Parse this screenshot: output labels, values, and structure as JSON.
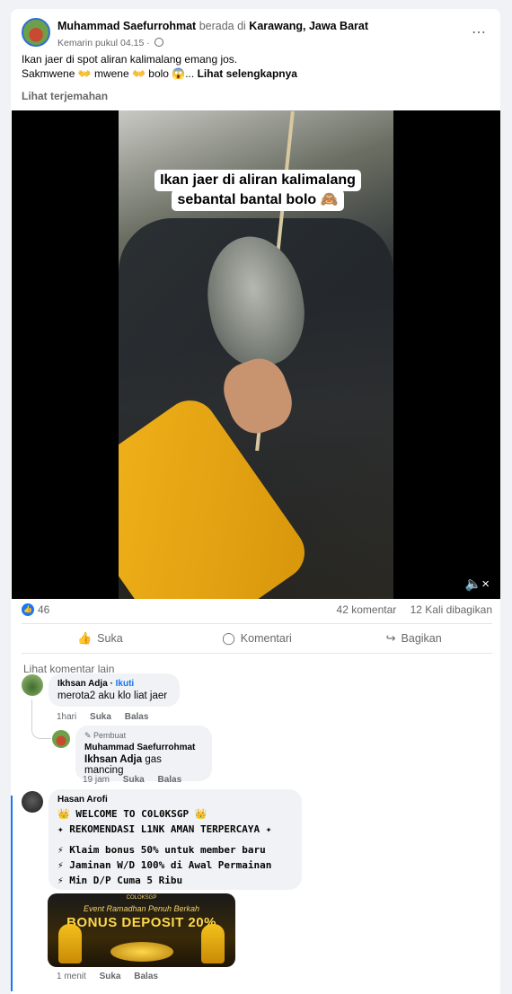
{
  "post": {
    "author": "Muhammad Saefurrohmat",
    "at_text": "berada di",
    "location": "Karawang, Jawa Barat",
    "time": "Kemarin pukul 04.15",
    "text_line1": "Ikan jaer di spot aliran kalimalang emang jos.",
    "text_line2": "Sakmwene 👐 mwene 👐 bolo 😱...",
    "see_more": "Lihat selengkapnya",
    "translate": "Lihat terjemahan",
    "more_icon": "⋯"
  },
  "video": {
    "caption_line1": "Ikan jaer di aliran kalimalang",
    "caption_line2": "sebantal bantal bolo 🙈",
    "mute_icon": "🔈×"
  },
  "stats": {
    "likes": "46",
    "comments": "42 komentar",
    "shares": "12 Kali dibagikan"
  },
  "actions": {
    "like": "Suka",
    "comment": "Komentari",
    "share": "Bagikan"
  },
  "comments_link": "Lihat komentar lain",
  "comments": [
    {
      "name": "Ikhsan Adja",
      "follow": "Ikuti",
      "text": "merota2 aku klo liat jaer",
      "time": "1hari",
      "like": "Suka",
      "reply": "Balas"
    },
    {
      "badge": "Pembuat",
      "name": "Muhammad Saefurrohmat",
      "mention": "Ikhsan Adja",
      "text": "gas mancing",
      "time": "19 jam",
      "like": "Suka",
      "reply": "Balas"
    },
    {
      "name": "Hasan Arofi",
      "lines": [
        "👑 WELCOME TO C0L0KSGP 👑",
        "✦ REKOMENDASI L1NK AMAN TERPERCAYA ✦",
        "",
        "⚡ Klaim bonus 50% untuk member baru",
        "⚡ Jaminan W/D 100% di Awal Permainan",
        "⚡ Min D/P Cuma 5 Ribu"
      ],
      "promo_brand": "COLOKSGP",
      "promo_event": "Event Ramadhan Penuh Berkah",
      "promo_title": "BONUS DEPOSIT 20%",
      "time": "1 menit",
      "like": "Suka",
      "reply": "Balas"
    }
  ],
  "colors": {
    "accent": "#1877f2",
    "muted": "#65676b",
    "bubble": "#f0f2f5"
  }
}
